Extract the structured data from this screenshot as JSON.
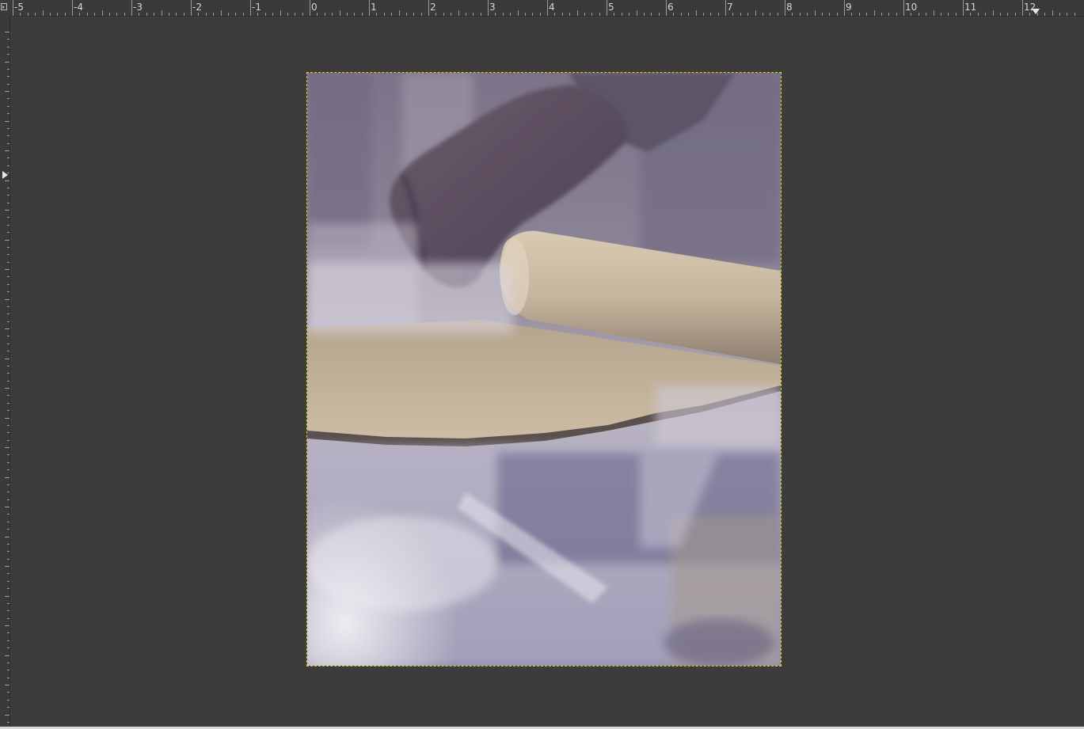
{
  "window": {
    "canvas_color": "#3c3c3c",
    "layer_boundary_color": "#e3d21a"
  },
  "ruler_top": {
    "labels": [
      "-5",
      "-4",
      "-3",
      "-2",
      "-1",
      "0",
      "1",
      "2",
      "3",
      "4",
      "5",
      "6",
      "7",
      "8",
      "9",
      "10",
      "11",
      "12"
    ]
  },
  "ruler_corner": {
    "icon": "quick-mask-toggle-icon"
  },
  "image": {
    "subject": "photo",
    "icon": "image-canvas"
  }
}
